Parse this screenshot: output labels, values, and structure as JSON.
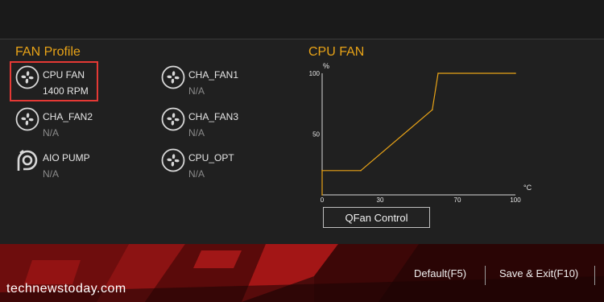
{
  "fan_profile": {
    "title": "FAN Profile",
    "fans": [
      {
        "name": "CPU FAN",
        "value": "1400 RPM",
        "icon": "fan-icon",
        "active": true
      },
      {
        "name": "CHA_FAN1",
        "value": "N/A",
        "icon": "fan-icon"
      },
      {
        "name": "CHA_FAN2",
        "value": "N/A",
        "icon": "fan-icon"
      },
      {
        "name": "CHA_FAN3",
        "value": "N/A",
        "icon": "fan-icon"
      },
      {
        "name": "AIO PUMP",
        "value": "N/A",
        "icon": "pump-icon"
      },
      {
        "name": "CPU_OPT",
        "value": "N/A",
        "icon": "fan-icon"
      }
    ]
  },
  "cpu_fan_panel": {
    "title": "CPU FAN",
    "button_label": "QFan Control"
  },
  "chart_data": {
    "type": "line",
    "title": "CPU FAN",
    "xlabel": "°C",
    "ylabel": "%",
    "xlim": [
      0,
      100
    ],
    "ylim": [
      0,
      100
    ],
    "x_ticks": [
      "0",
      "30",
      "70",
      "100"
    ],
    "y_ticks": [
      "50",
      "100"
    ],
    "series": [
      {
        "x": [
          0,
          0,
          20,
          57,
          60,
          100
        ],
        "values": [
          0,
          20,
          20,
          70,
          100,
          100
        ],
        "color": "#e8a317"
      }
    ]
  },
  "footer": {
    "default_label": "Default(F5)",
    "save_exit_label": "Save & Exit(F10)",
    "watermark": "technewstoday.com"
  },
  "colors": {
    "accent": "#e8a317",
    "highlight": "#e53935"
  }
}
